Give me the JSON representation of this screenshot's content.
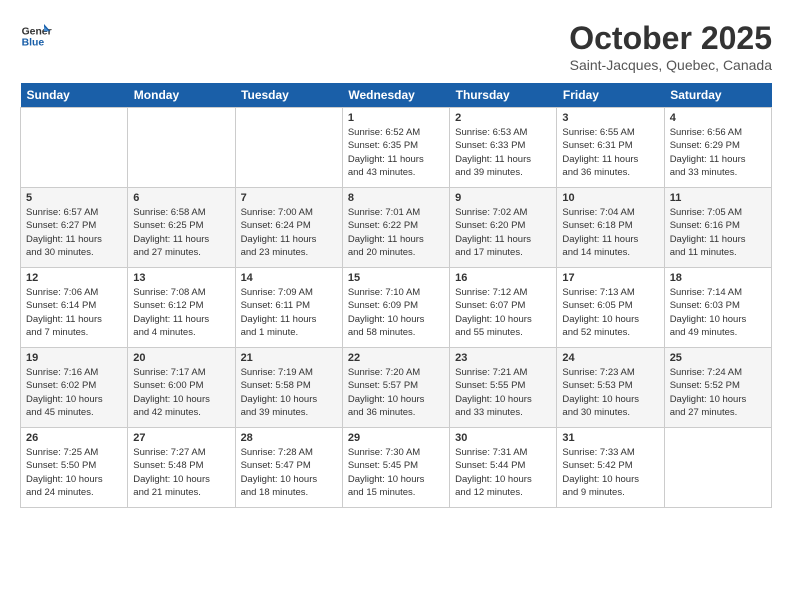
{
  "header": {
    "logo_line1": "General",
    "logo_line2": "Blue",
    "month": "October 2025",
    "location": "Saint-Jacques, Quebec, Canada"
  },
  "weekdays": [
    "Sunday",
    "Monday",
    "Tuesday",
    "Wednesday",
    "Thursday",
    "Friday",
    "Saturday"
  ],
  "weeks": [
    [
      {
        "day": "",
        "info": ""
      },
      {
        "day": "",
        "info": ""
      },
      {
        "day": "",
        "info": ""
      },
      {
        "day": "1",
        "info": "Sunrise: 6:52 AM\nSunset: 6:35 PM\nDaylight: 11 hours\nand 43 minutes."
      },
      {
        "day": "2",
        "info": "Sunrise: 6:53 AM\nSunset: 6:33 PM\nDaylight: 11 hours\nand 39 minutes."
      },
      {
        "day": "3",
        "info": "Sunrise: 6:55 AM\nSunset: 6:31 PM\nDaylight: 11 hours\nand 36 minutes."
      },
      {
        "day": "4",
        "info": "Sunrise: 6:56 AM\nSunset: 6:29 PM\nDaylight: 11 hours\nand 33 minutes."
      }
    ],
    [
      {
        "day": "5",
        "info": "Sunrise: 6:57 AM\nSunset: 6:27 PM\nDaylight: 11 hours\nand 30 minutes."
      },
      {
        "day": "6",
        "info": "Sunrise: 6:58 AM\nSunset: 6:25 PM\nDaylight: 11 hours\nand 27 minutes."
      },
      {
        "day": "7",
        "info": "Sunrise: 7:00 AM\nSunset: 6:24 PM\nDaylight: 11 hours\nand 23 minutes."
      },
      {
        "day": "8",
        "info": "Sunrise: 7:01 AM\nSunset: 6:22 PM\nDaylight: 11 hours\nand 20 minutes."
      },
      {
        "day": "9",
        "info": "Sunrise: 7:02 AM\nSunset: 6:20 PM\nDaylight: 11 hours\nand 17 minutes."
      },
      {
        "day": "10",
        "info": "Sunrise: 7:04 AM\nSunset: 6:18 PM\nDaylight: 11 hours\nand 14 minutes."
      },
      {
        "day": "11",
        "info": "Sunrise: 7:05 AM\nSunset: 6:16 PM\nDaylight: 11 hours\nand 11 minutes."
      }
    ],
    [
      {
        "day": "12",
        "info": "Sunrise: 7:06 AM\nSunset: 6:14 PM\nDaylight: 11 hours\nand 7 minutes."
      },
      {
        "day": "13",
        "info": "Sunrise: 7:08 AM\nSunset: 6:12 PM\nDaylight: 11 hours\nand 4 minutes."
      },
      {
        "day": "14",
        "info": "Sunrise: 7:09 AM\nSunset: 6:11 PM\nDaylight: 11 hours\nand 1 minute."
      },
      {
        "day": "15",
        "info": "Sunrise: 7:10 AM\nSunset: 6:09 PM\nDaylight: 10 hours\nand 58 minutes."
      },
      {
        "day": "16",
        "info": "Sunrise: 7:12 AM\nSunset: 6:07 PM\nDaylight: 10 hours\nand 55 minutes."
      },
      {
        "day": "17",
        "info": "Sunrise: 7:13 AM\nSunset: 6:05 PM\nDaylight: 10 hours\nand 52 minutes."
      },
      {
        "day": "18",
        "info": "Sunrise: 7:14 AM\nSunset: 6:03 PM\nDaylight: 10 hours\nand 49 minutes."
      }
    ],
    [
      {
        "day": "19",
        "info": "Sunrise: 7:16 AM\nSunset: 6:02 PM\nDaylight: 10 hours\nand 45 minutes."
      },
      {
        "day": "20",
        "info": "Sunrise: 7:17 AM\nSunset: 6:00 PM\nDaylight: 10 hours\nand 42 minutes."
      },
      {
        "day": "21",
        "info": "Sunrise: 7:19 AM\nSunset: 5:58 PM\nDaylight: 10 hours\nand 39 minutes."
      },
      {
        "day": "22",
        "info": "Sunrise: 7:20 AM\nSunset: 5:57 PM\nDaylight: 10 hours\nand 36 minutes."
      },
      {
        "day": "23",
        "info": "Sunrise: 7:21 AM\nSunset: 5:55 PM\nDaylight: 10 hours\nand 33 minutes."
      },
      {
        "day": "24",
        "info": "Sunrise: 7:23 AM\nSunset: 5:53 PM\nDaylight: 10 hours\nand 30 minutes."
      },
      {
        "day": "25",
        "info": "Sunrise: 7:24 AM\nSunset: 5:52 PM\nDaylight: 10 hours\nand 27 minutes."
      }
    ],
    [
      {
        "day": "26",
        "info": "Sunrise: 7:25 AM\nSunset: 5:50 PM\nDaylight: 10 hours\nand 24 minutes."
      },
      {
        "day": "27",
        "info": "Sunrise: 7:27 AM\nSunset: 5:48 PM\nDaylight: 10 hours\nand 21 minutes."
      },
      {
        "day": "28",
        "info": "Sunrise: 7:28 AM\nSunset: 5:47 PM\nDaylight: 10 hours\nand 18 minutes."
      },
      {
        "day": "29",
        "info": "Sunrise: 7:30 AM\nSunset: 5:45 PM\nDaylight: 10 hours\nand 15 minutes."
      },
      {
        "day": "30",
        "info": "Sunrise: 7:31 AM\nSunset: 5:44 PM\nDaylight: 10 hours\nand 12 minutes."
      },
      {
        "day": "31",
        "info": "Sunrise: 7:33 AM\nSunset: 5:42 PM\nDaylight: 10 hours\nand 9 minutes."
      },
      {
        "day": "",
        "info": ""
      }
    ]
  ]
}
